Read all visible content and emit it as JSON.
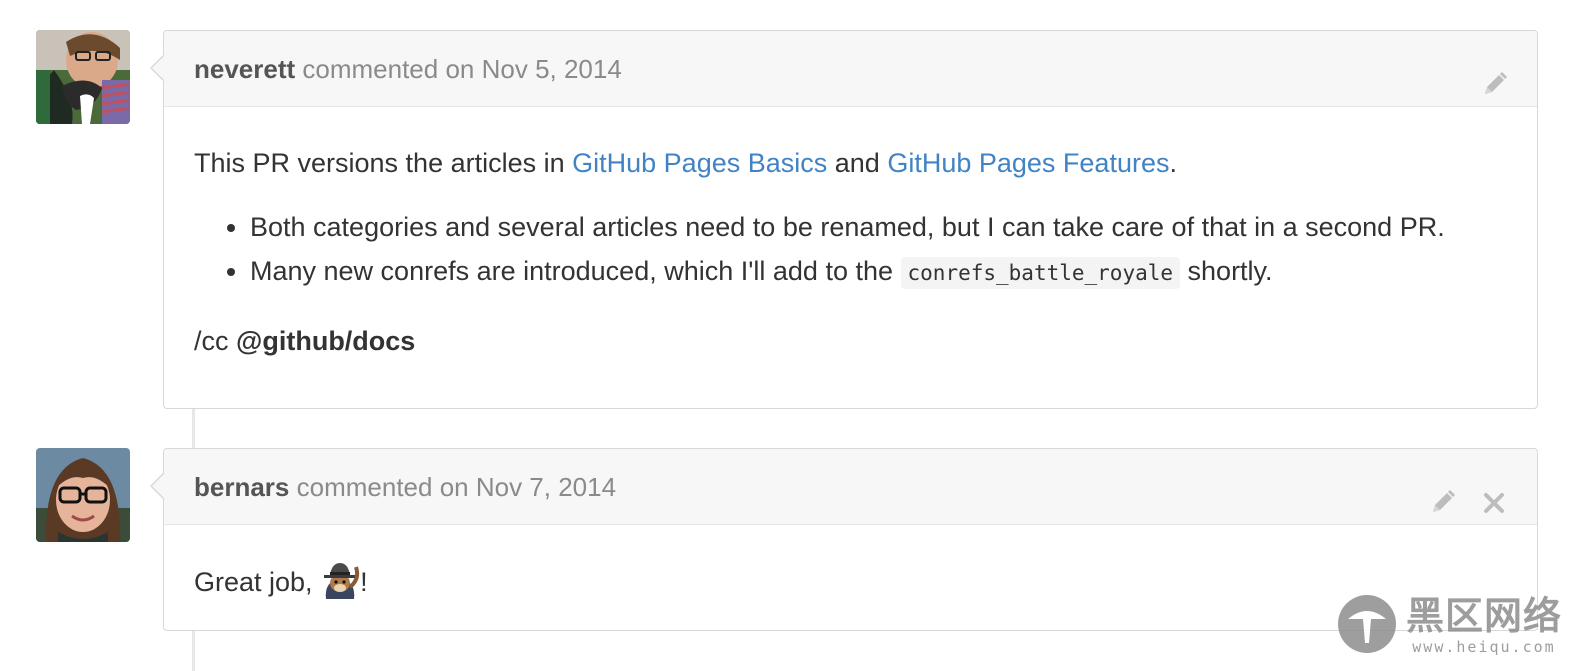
{
  "comments": [
    {
      "author": "neverett",
      "action": "commented on",
      "date": "Nov 5, 2014",
      "body": {
        "intro_prefix": "This PR versions the articles in ",
        "link1": "GitHub Pages Basics",
        "intro_and": " and ",
        "link2": "GitHub Pages Features",
        "intro_suffix": ".",
        "bullets": [
          {
            "text": "Both categories and several articles need to be renamed, but I can take care of that in a second PR."
          },
          {
            "prefix": "Many new conrefs are introduced, which I'll add to the ",
            "code": "conrefs_battle_royale",
            "suffix": " shortly."
          }
        ],
        "cc_prefix": "/cc ",
        "cc_mention": "@github/docs"
      },
      "icons": [
        "pencil-icon"
      ]
    },
    {
      "author": "bernars",
      "action": "commented on",
      "date": "Nov 7, 2014",
      "body": {
        "text": "Great job, ",
        "emoji": "squirrel-hat-emoji",
        "suffix": "!"
      },
      "icons": [
        "pencil-icon",
        "close-icon"
      ]
    }
  ],
  "watermark": {
    "title": "黑区网络",
    "url": "www.heiqu.com"
  },
  "colors": {
    "link": "#4183c4",
    "header_bg": "#f7f7f7",
    "border": "#d8d8d8",
    "author": "#555555",
    "meta": "#8a8a8a"
  }
}
